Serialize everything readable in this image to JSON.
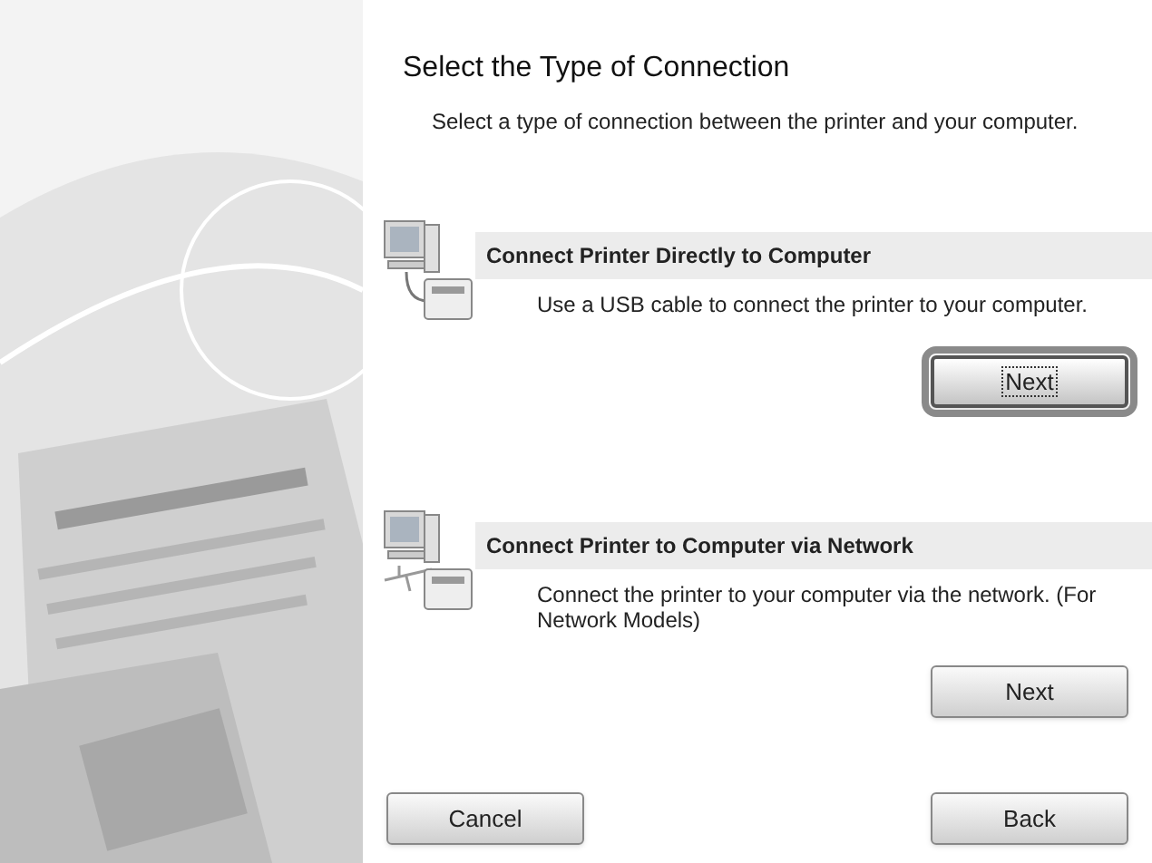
{
  "title": "Select the Type of Connection",
  "subtitle": "Select a type of connection between the printer and your computer.",
  "options": [
    {
      "kind": "usb",
      "heading": "Connect Printer Directly to Computer",
      "description": "Use a USB cable to connect the printer to your computer.",
      "button": {
        "label": "Next",
        "focused": true
      }
    },
    {
      "kind": "network",
      "heading": "Connect Printer to Computer via Network",
      "description": "Connect the printer to your computer via the network. (For Network Models)",
      "button": {
        "label": "Next",
        "focused": false
      }
    }
  ],
  "footer": {
    "cancel": "Cancel",
    "back": "Back"
  }
}
